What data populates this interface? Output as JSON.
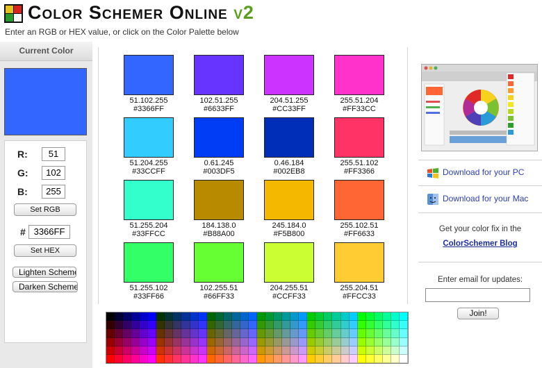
{
  "header": {
    "title": "Color Schemer Online",
    "version": "v2",
    "subtitle": "Enter an RGB or HEX value, or click on the Color Palette below"
  },
  "current": {
    "heading": "Current Color",
    "color": "#3366FF",
    "r_label": "R:",
    "g_label": "G:",
    "b_label": "B:",
    "r": "51",
    "g": "102",
    "b": "255",
    "set_rgb": "Set RGB",
    "hash": "#",
    "hex": "3366FF",
    "set_hex": "Set HEX",
    "lighten": "Lighten Scheme",
    "darken": "Darken Scheme"
  },
  "swatches": [
    {
      "rgb": "51.102.255",
      "hex": "#3366FF",
      "color": "#3366FF"
    },
    {
      "rgb": "102.51.255",
      "hex": "#6633FF",
      "color": "#6633FF"
    },
    {
      "rgb": "204.51.255",
      "hex": "#CC33FF",
      "color": "#CC33FF"
    },
    {
      "rgb": "255.51.204",
      "hex": "#FF33CC",
      "color": "#FF33CC"
    },
    {
      "rgb": "51.204.255",
      "hex": "#33CCFF",
      "color": "#33CCFF"
    },
    {
      "rgb": "0.61.245",
      "hex": "#003DF5",
      "color": "#003DF5"
    },
    {
      "rgb": "0.46.184",
      "hex": "#002EB8",
      "color": "#002EB8"
    },
    {
      "rgb": "255.51.102",
      "hex": "#FF3366",
      "color": "#FF3366"
    },
    {
      "rgb": "51.255.204",
      "hex": "#33FFCC",
      "color": "#33FFCC"
    },
    {
      "rgb": "184.138.0",
      "hex": "#B88A00",
      "color": "#B88A00"
    },
    {
      "rgb": "245.184.0",
      "hex": "#F5B800",
      "color": "#F5B800"
    },
    {
      "rgb": "255.102.51",
      "hex": "#FF6633",
      "color": "#FF6633"
    },
    {
      "rgb": "51.255.102",
      "hex": "#33FF66",
      "color": "#33FF66"
    },
    {
      "rgb": "102.255.51",
      "hex": "#66FF33",
      "color": "#66FF33"
    },
    {
      "rgb": "204.255.51",
      "hex": "#CCFF33",
      "color": "#CCFF33"
    },
    {
      "rgb": "255.204.51",
      "hex": "#FFCC33",
      "color": "#FFCC33"
    }
  ],
  "sidebar": {
    "download_pc": "Download for your PC",
    "download_mac": "Download for your Mac",
    "fix_text": "Get your color fix in the",
    "blog_link": "ColorSchemer Blog",
    "email_label": "Enter email for updates:",
    "email_value": "",
    "join": "Join!"
  },
  "icons": {
    "logo": "color-schemer-logo-icon",
    "pc": "windows-logo-icon",
    "mac": "mac-finder-icon"
  }
}
